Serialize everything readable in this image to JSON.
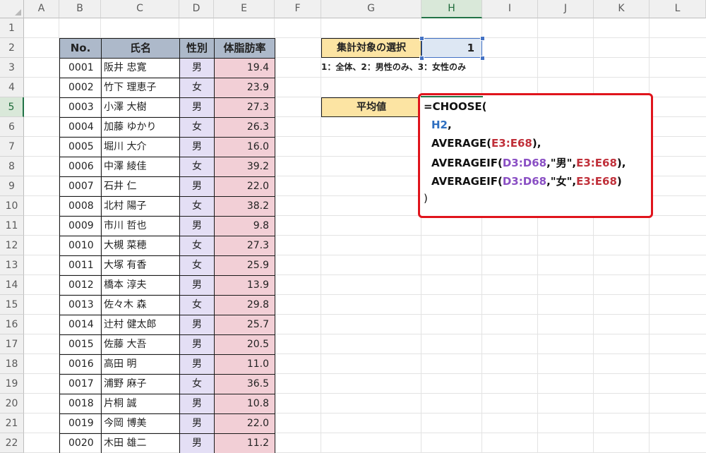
{
  "columns": [
    "A",
    "B",
    "C",
    "D",
    "E",
    "F",
    "G",
    "H",
    "I",
    "J",
    "K",
    "L"
  ],
  "active_column": "H",
  "rows": [
    "1",
    "2",
    "3",
    "4",
    "5",
    "6",
    "7",
    "8",
    "9",
    "10",
    "11",
    "12",
    "13",
    "14",
    "15",
    "16",
    "17",
    "18",
    "19",
    "20",
    "21",
    "22"
  ],
  "active_row": "5",
  "table": {
    "headers": {
      "no": "No.",
      "name": "氏名",
      "sex": "性別",
      "fat": "体脂肪率"
    },
    "records": [
      {
        "no": "0001",
        "name": "阪井 忠寛",
        "sex": "男",
        "fat": "19.4"
      },
      {
        "no": "0002",
        "name": "竹下 理恵子",
        "sex": "女",
        "fat": "23.9"
      },
      {
        "no": "0003",
        "name": "小澤 大樹",
        "sex": "男",
        "fat": "27.3"
      },
      {
        "no": "0004",
        "name": "加藤 ゆかり",
        "sex": "女",
        "fat": "26.3"
      },
      {
        "no": "0005",
        "name": "堀川 大介",
        "sex": "男",
        "fat": "16.0"
      },
      {
        "no": "0006",
        "name": "中澤 綾佳",
        "sex": "女",
        "fat": "39.2"
      },
      {
        "no": "0007",
        "name": "石井 仁",
        "sex": "男",
        "fat": "22.0"
      },
      {
        "no": "0008",
        "name": "北村 陽子",
        "sex": "女",
        "fat": "38.2"
      },
      {
        "no": "0009",
        "name": "市川 哲也",
        "sex": "男",
        "fat": "9.8"
      },
      {
        "no": "0010",
        "name": "大槻 菜穂",
        "sex": "女",
        "fat": "27.3"
      },
      {
        "no": "0011",
        "name": "大塚 有香",
        "sex": "女",
        "fat": "25.9"
      },
      {
        "no": "0012",
        "name": "橋本 淳夫",
        "sex": "男",
        "fat": "13.9"
      },
      {
        "no": "0013",
        "name": "佐々木 森",
        "sex": "女",
        "fat": "29.8"
      },
      {
        "no": "0014",
        "name": "辻村 健太郎",
        "sex": "男",
        "fat": "25.7"
      },
      {
        "no": "0015",
        "name": "佐藤 大吾",
        "sex": "男",
        "fat": "20.5"
      },
      {
        "no": "0016",
        "name": "高田 明",
        "sex": "男",
        "fat": "11.0"
      },
      {
        "no": "0017",
        "name": "浦野 麻子",
        "sex": "女",
        "fat": "36.5"
      },
      {
        "no": "0018",
        "name": "片桐 誠",
        "sex": "男",
        "fat": "10.8"
      },
      {
        "no": "0019",
        "name": "今岡 博美",
        "sex": "男",
        "fat": "22.0"
      },
      {
        "no": "0020",
        "name": "木田 雄二",
        "sex": "男",
        "fat": "11.2"
      }
    ]
  },
  "selector": {
    "label": "集計対象の選択",
    "value": "1",
    "note": "1：全体、2：男性のみ、3：女性のみ"
  },
  "average": {
    "label": "平均値"
  },
  "formula": {
    "line1": {
      "eq": "=CHOOSE("
    },
    "line2": {
      "ref": "H2",
      "comma": ","
    },
    "line3": {
      "fn": "AVERAGE(",
      "ref": "E3:E68",
      "tail": "),"
    },
    "line4": {
      "fn": "AVERAGEIF(",
      "ref1": "D3:D68",
      "mid": ",\"男\",",
      "ref2": "E3:E68",
      "tail": "),"
    },
    "line5": {
      "fn": "AVERAGEIF(",
      "ref1": "D3:D68",
      "mid": ",\"女\",",
      "ref2": "E3:E68",
      "tail": ")"
    },
    "line6": {
      "close": ")"
    }
  },
  "colors": {
    "header_fill": "#adb9ca",
    "sex_fill": "#e4dff5",
    "fat_fill": "#f2cfd6",
    "label_fill": "#fce4a3",
    "value_fill": "#dde7f3",
    "highlight_border": "#e0141c",
    "ref_blue": "#2f6fc0",
    "ref_red": "#c0303a",
    "ref_purple": "#8a4fc4"
  }
}
